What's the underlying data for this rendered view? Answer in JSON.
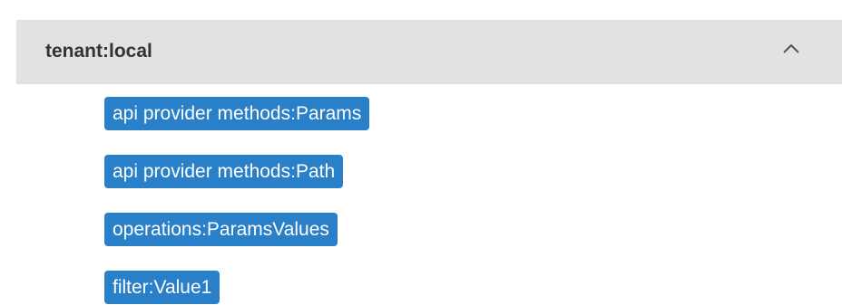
{
  "panel": {
    "title": "tenant:local",
    "collapse_icon": "chevron-up-icon",
    "tags": [
      "api provider methods:Params",
      "api provider methods:Path",
      "operations:ParamsValues",
      "filter:Value1"
    ]
  },
  "colors": {
    "header_bg": "#e2e2e2",
    "tag_bg": "#2a7fc9",
    "tag_text": "#ffffff",
    "title_text": "#333333"
  }
}
